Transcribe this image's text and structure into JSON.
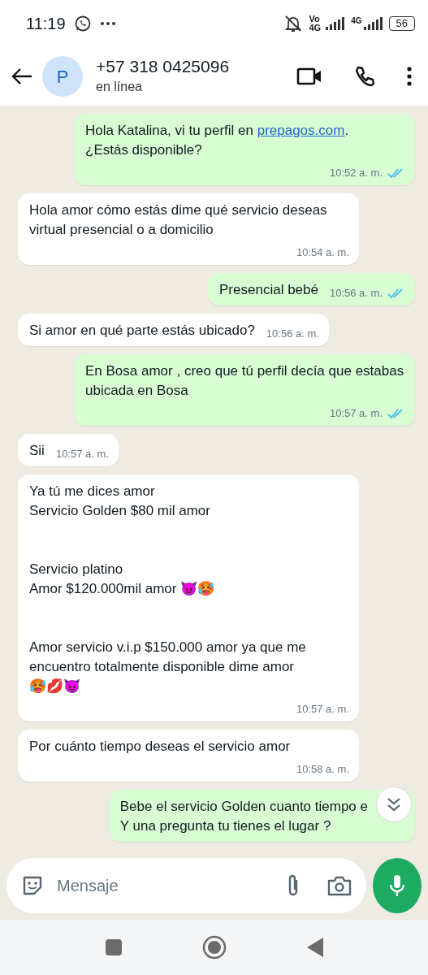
{
  "status_bar": {
    "time": "11:19",
    "network_label": "Vo\n4G",
    "network_label_2": "4G",
    "battery": "56"
  },
  "header": {
    "avatar_letter": "P",
    "contact": "+57 318 0425096",
    "presence": "en línea"
  },
  "messages": [
    {
      "kind": "sent",
      "parts": [
        {
          "kind": "plain",
          "text": "Hola Katalina, vi tu perfil en "
        },
        {
          "kind": "link",
          "text": "prepagos.com"
        },
        {
          "kind": "plain",
          "text": ".\n¿Estás disponible?"
        }
      ],
      "time": "10:52 a. m.",
      "read": true
    },
    {
      "kind": "received",
      "parts": [
        {
          "kind": "plain",
          "text": "Hola amor cómo estás dime qué servicio deseas virtual presencial o a domicilio"
        }
      ],
      "time": "10:54 a. m."
    },
    {
      "kind": "sent",
      "parts": [
        {
          "kind": "plain",
          "text": "Presencial bebé"
        }
      ],
      "time": "10:56 a. m.",
      "read": true
    },
    {
      "kind": "received",
      "parts": [
        {
          "kind": "plain",
          "text": "Si amor en qué parte estás ubicado?"
        }
      ],
      "time": "10:56 a. m."
    },
    {
      "kind": "sent",
      "parts": [
        {
          "kind": "plain",
          "text": "En Bosa amor , creo que tú perfil decía que estabas ubicada en Bosa"
        }
      ],
      "time": "10:57 a. m.",
      "read": true
    },
    {
      "kind": "received",
      "parts": [
        {
          "kind": "plain",
          "text": "Sii"
        }
      ],
      "time": "10:57 a. m."
    },
    {
      "kind": "received",
      "parts": [
        {
          "kind": "plain",
          "text": "Ya tú me dices amor\nServicio Golden $80 mil amor\n\n\nServicio platino\nAmor $120.000mil amor 😈🥵\n\n\nAmor servicio v.i.p $150.000 amor ya que me encuentro totalmente disponible dime amor\n🥵💋😈"
        }
      ],
      "time": "10:57 a. m."
    },
    {
      "kind": "received",
      "parts": [
        {
          "kind": "plain",
          "text": "Por cuánto tiempo deseas el servicio amor"
        }
      ],
      "time": "10:58 a. m."
    },
    {
      "kind": "sent",
      "parts": [
        {
          "kind": "plain",
          "text": "Bebe el servicio Golden cuanto tiempo e\nY una pregunta tu tienes el lugar ?"
        }
      ]
    }
  ],
  "composer": {
    "placeholder": "Mensaje"
  }
}
